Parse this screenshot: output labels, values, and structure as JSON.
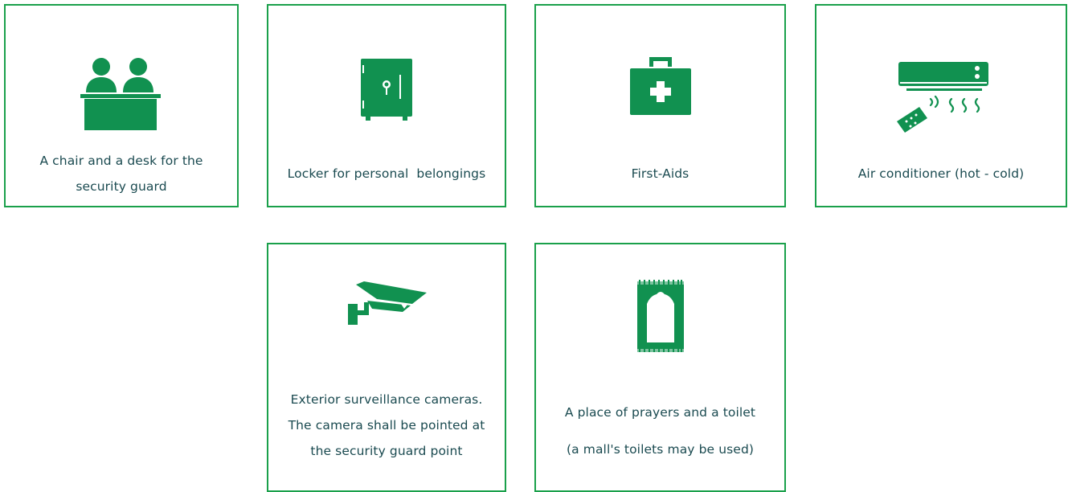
{
  "theme": {
    "accent": "#1aa04b",
    "icon_fill": "#119150",
    "text": "#1a4a50",
    "background": "#ffffff"
  },
  "cards": [
    {
      "icon": "security-desk-icon",
      "lines": [
        "A chair and a desk for the",
        "security guard"
      ]
    },
    {
      "icon": "locker-icon",
      "lines": [
        "Locker for personal  belongings"
      ]
    },
    {
      "icon": "first-aid-kit-icon",
      "lines": [
        "First-Aids"
      ]
    },
    {
      "icon": "air-conditioner-icon",
      "lines": [
        "Air conditioner (hot - cold)"
      ]
    },
    {
      "icon": "surveillance-camera-icon",
      "lines": [
        "Exterior surveillance cameras.",
        "The camera shall be pointed at",
        "the security guard point"
      ]
    },
    {
      "icon": "prayer-rug-icon",
      "lines": [
        "A place of prayers and a toilet",
        "(a mall's toilets may be used)"
      ]
    }
  ]
}
